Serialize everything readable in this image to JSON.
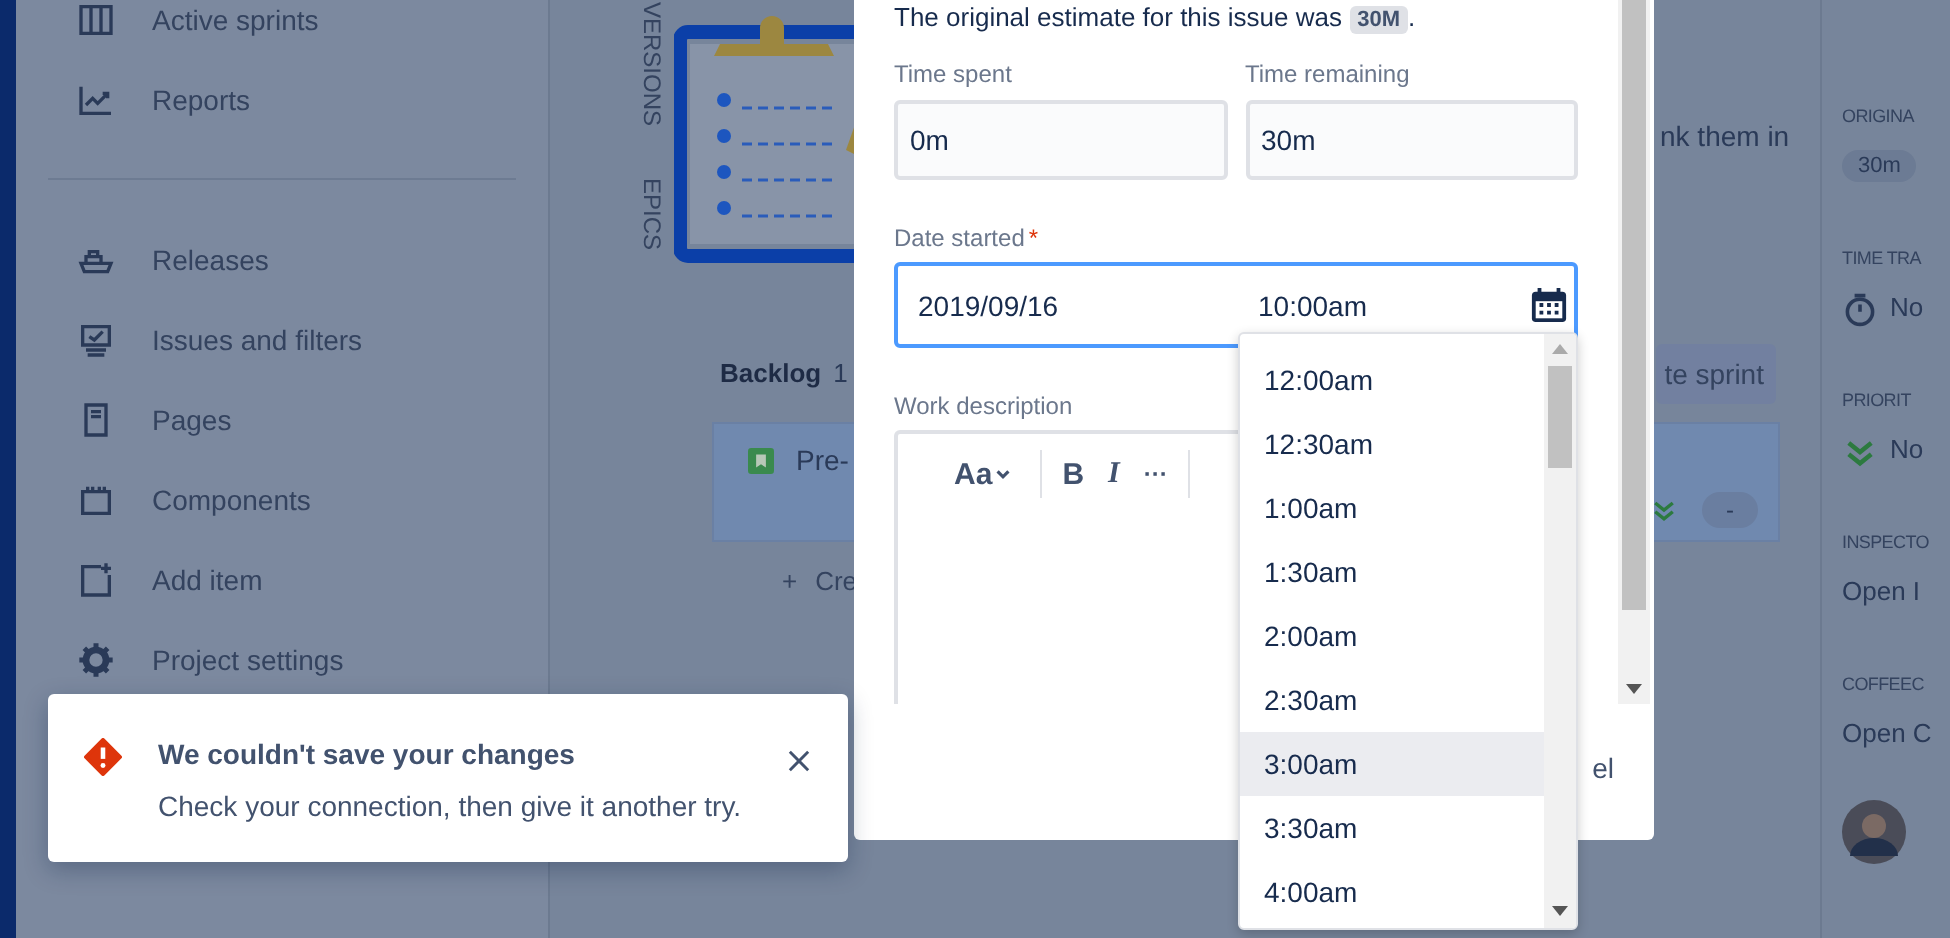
{
  "sidebar": {
    "groups": [
      {
        "items": [
          {
            "label": "Active sprints"
          },
          {
            "label": "Reports"
          }
        ]
      },
      {
        "items": [
          {
            "label": "Releases"
          },
          {
            "label": "Issues and filters"
          },
          {
            "label": "Pages"
          },
          {
            "label": "Components"
          },
          {
            "label": "Add item"
          },
          {
            "label": "Project settings"
          }
        ]
      }
    ]
  },
  "board": {
    "side_tabs": [
      "VERSIONS",
      "EPICS"
    ],
    "hint": "nk them in",
    "backlog": {
      "title": "Backlog",
      "count": "1"
    },
    "create_sprint": "te sprint",
    "card": {
      "summary": "Pre-",
      "estimate": "-"
    },
    "create_issue": {
      "mark": "+",
      "label": "Cre"
    }
  },
  "details": {
    "fields": [
      {
        "label": "ORIGINA",
        "kind": "pill",
        "value": "30m"
      },
      {
        "label": "TIME TRA",
        "kind": "tracking",
        "value": "No"
      },
      {
        "label": "PRIORIT",
        "kind": "priority",
        "value": "No"
      },
      {
        "label": "INSPECTO",
        "kind": "text",
        "value": "Open I"
      },
      {
        "label": "COFFEEC",
        "kind": "text",
        "value": "Open C"
      }
    ]
  },
  "dialog": {
    "estimate_note": {
      "text": "The original estimate for this issue was",
      "value": "30M",
      "end": "."
    },
    "time_spent": {
      "label": "Time spent",
      "value": "0m"
    },
    "time_remaining": {
      "label": "Time remaining",
      "value": "30m"
    },
    "date_started": {
      "label": "Date started",
      "required_mark": "*",
      "date": "2019/09/16",
      "time": "10:00am"
    },
    "work_description": {
      "label": "Work description",
      "toolbar": [
        "Aa",
        "B",
        "I",
        "···"
      ]
    },
    "footer_button": "el"
  },
  "time_menu": {
    "options": [
      {
        "label": "12:00am",
        "selected": false
      },
      {
        "label": "12:30am",
        "selected": false
      },
      {
        "label": "1:00am",
        "selected": false
      },
      {
        "label": "1:30am",
        "selected": false
      },
      {
        "label": "2:00am",
        "selected": false
      },
      {
        "label": "2:30am",
        "selected": false
      },
      {
        "label": "3:00am",
        "selected": true
      },
      {
        "label": "3:30am",
        "selected": false
      },
      {
        "label": "4:00am",
        "selected": false
      }
    ]
  },
  "toast": {
    "title": "We couldn't save your changes",
    "message": "Check your connection, then give it another try."
  }
}
